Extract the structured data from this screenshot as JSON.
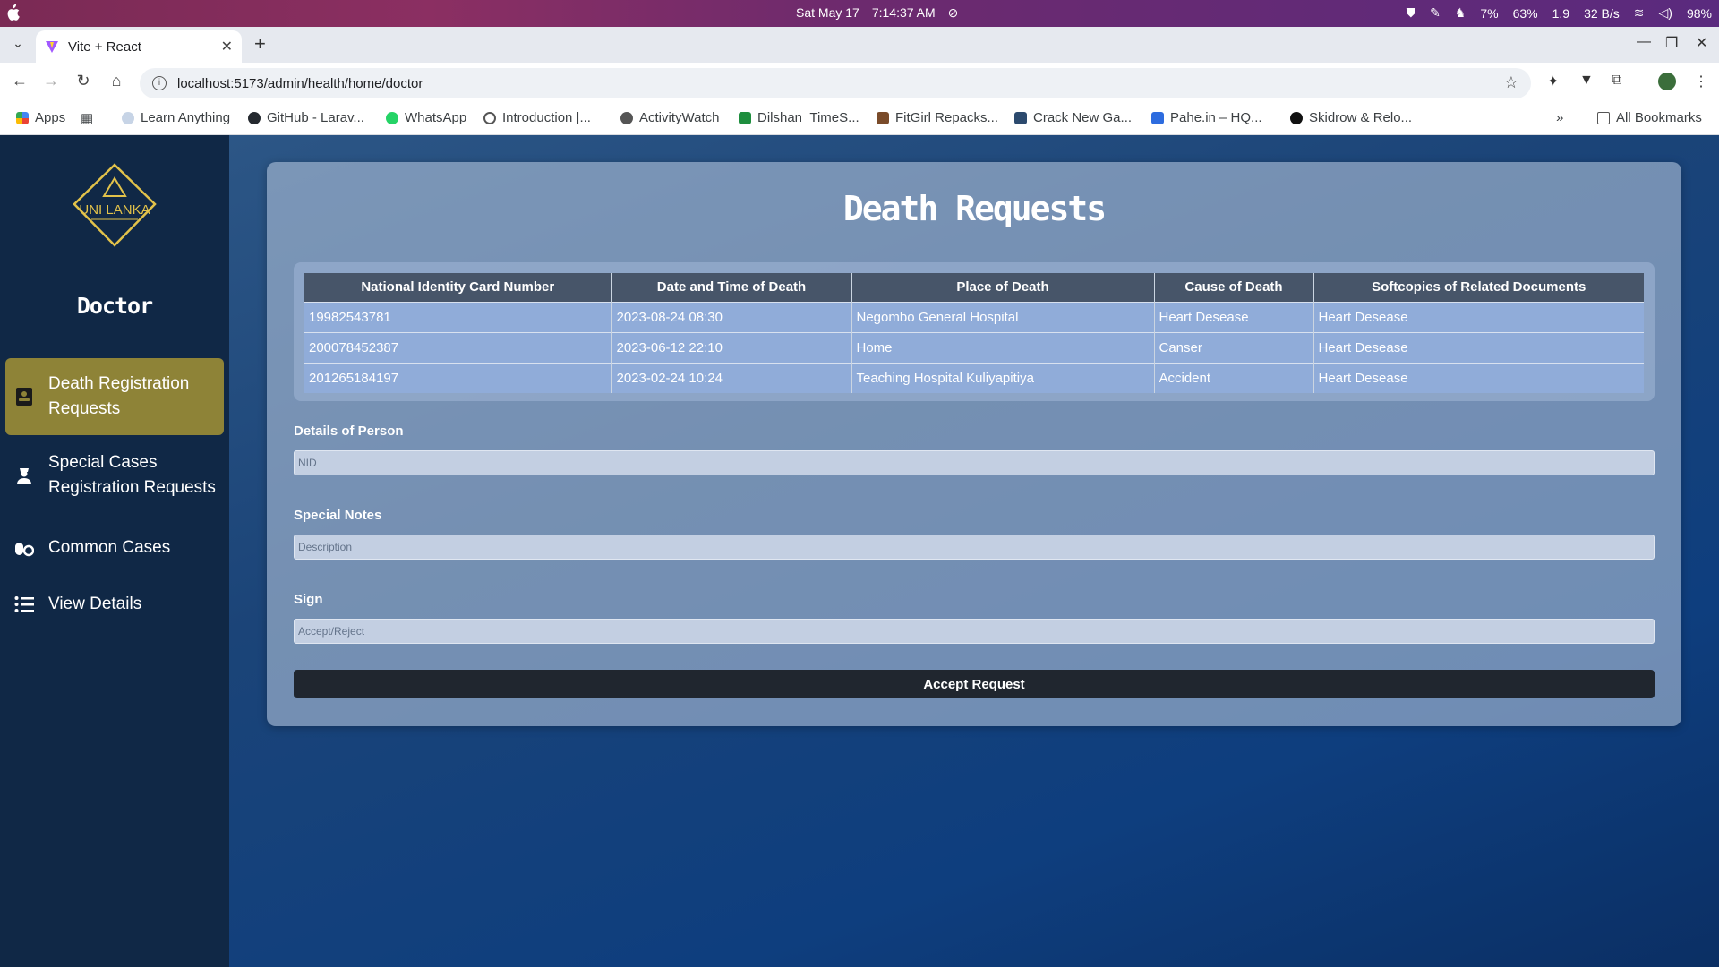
{
  "system_bar": {
    "date": "Sat May 17",
    "time": "7:14:37 AM",
    "cpu": "7%",
    "memory": "63%",
    "load": "1.9",
    "network": "32 B/s",
    "battery": "98%"
  },
  "browser": {
    "tab_title": "Vite + React",
    "url": "localhost:5173/admin/health/home/doctor",
    "bookmarks": [
      "Apps",
      "Learn Anything",
      "GitHub - Larav...",
      "WhatsApp",
      "Introduction |...",
      "ActivityWatch",
      "Dilshan_TimeS...",
      "FitGirl Repacks...",
      "Crack New Ga...",
      "Pahe.in – HQ...",
      "Skidrow & Relo..."
    ],
    "all_bookmarks": "All Bookmarks"
  },
  "sidebar": {
    "logo_text": "UNI LANKA",
    "role": "Doctor",
    "items": [
      {
        "label": "Death Registration Requests",
        "icon": "id-badge-icon"
      },
      {
        "label": "Special Cases Registration Requests",
        "icon": "user-nurse-icon"
      },
      {
        "label": "Common Cases",
        "icon": "pills-icon"
      },
      {
        "label": "View Details",
        "icon": "list-icon"
      }
    ]
  },
  "main": {
    "title": "Death Requests",
    "table": {
      "headers": [
        "National Identity Card Number",
        "Date and Time of Death",
        "Place of Death",
        "Cause of Death",
        "Softcopies of Related Documents"
      ],
      "rows": [
        [
          "19982543781",
          "2023-08-24 08:30",
          "Negombo General Hospital",
          "Heart Desease",
          "Heart Desease"
        ],
        [
          "200078452387",
          "2023-06-12 22:10",
          "Home",
          "Canser",
          "Heart Desease"
        ],
        [
          "201265184197",
          "2023-02-24 10:24",
          "Teaching Hospital Kuliyapitiya",
          "Accident",
          "Heart Desease"
        ]
      ]
    },
    "form": {
      "person_label": "Details of Person",
      "person_placeholder": "NID",
      "notes_label": "Special Notes",
      "notes_placeholder": "Description",
      "sign_label": "Sign",
      "sign_placeholder": "Accept/Reject",
      "submit_label": "Accept Request"
    }
  },
  "colors": {
    "sidebar_bg": "#102846",
    "active_item": "#8e8337",
    "table_header": "#475569",
    "table_row": "#90acd9",
    "button": "#20262f"
  }
}
